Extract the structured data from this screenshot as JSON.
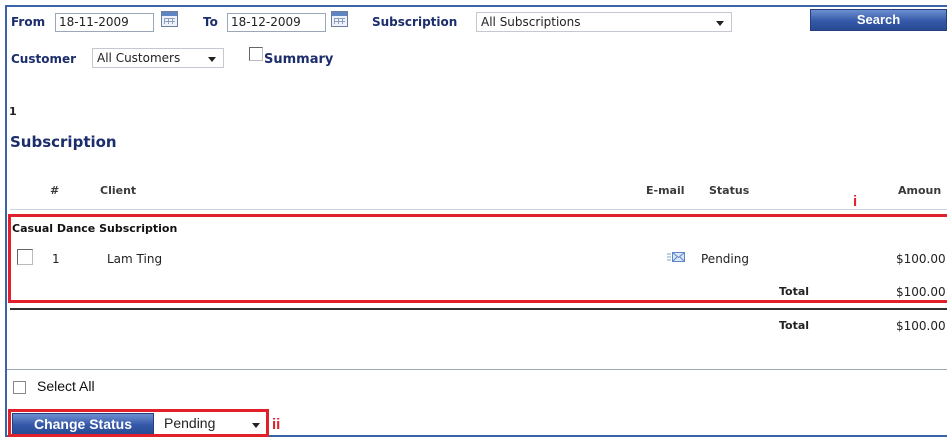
{
  "filters": {
    "from_label": "From",
    "from_value": "18-11-2009",
    "to_label": "To",
    "to_value": "18-12-2009",
    "subscription_label": "Subscription",
    "subscription_value": "All Subscriptions",
    "search_label": "Search",
    "customer_label": "Customer",
    "customer_value": "All Customers",
    "summary_label": "Summary"
  },
  "page_count": "1",
  "section_title": "Subscription",
  "table": {
    "headers": {
      "number": "#",
      "client": "Client",
      "email": "E-mail",
      "status": "Status",
      "amount": "Amoun"
    },
    "group_name": "Casual Dance Subscription",
    "rows": [
      {
        "number": "1",
        "client": "Lam Ting",
        "email_icon": "envelope-icon",
        "status": "Pending",
        "amount": "$100.00"
      }
    ],
    "group_total_label": "Total",
    "group_total_value": "$100.00",
    "grand_total_label": "Total",
    "grand_total_value": "$100.00"
  },
  "footer": {
    "select_all_label": "Select All",
    "change_status_label": "Change Status",
    "status_value": "Pending"
  },
  "annotations": {
    "mark_i": "i",
    "mark_ii": "ii"
  },
  "colors": {
    "accent": "#3559a8",
    "annotation": "#e0202a",
    "title": "#1b2d6b"
  }
}
